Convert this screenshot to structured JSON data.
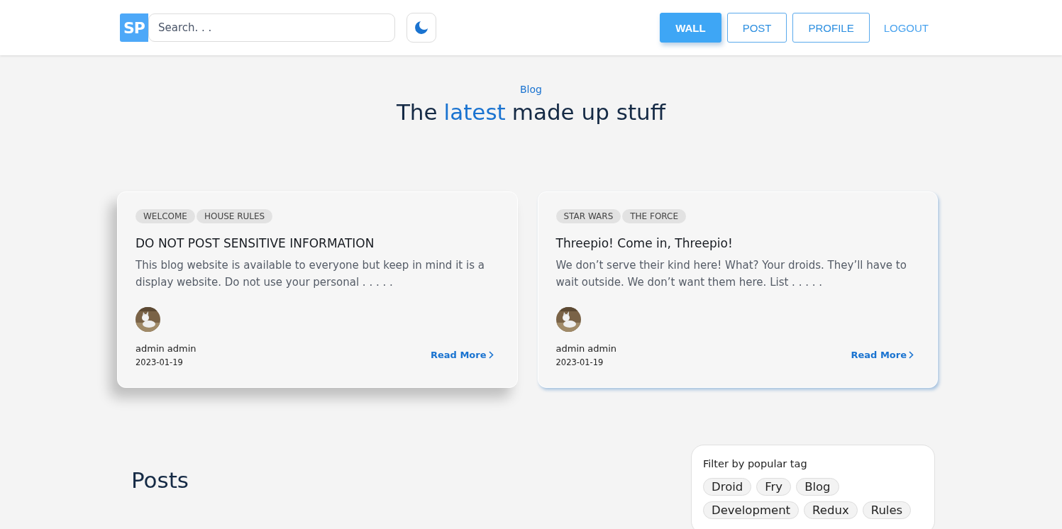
{
  "header": {
    "logo": "SP",
    "search": {
      "placeholder": "Search. . ."
    },
    "nav": [
      {
        "label": "WALL",
        "selected": true,
        "kind": "button"
      },
      {
        "label": "POST",
        "selected": false,
        "kind": "button"
      },
      {
        "label": "PROFILE",
        "selected": false,
        "kind": "button"
      },
      {
        "label": "LOGOUT",
        "selected": false,
        "kind": "link"
      }
    ]
  },
  "hero": {
    "eyebrow": "Blog",
    "title": [
      {
        "text": "The",
        "highlight": false
      },
      {
        "text": "latest",
        "highlight": true
      },
      {
        "text": "made up stuff",
        "highlight": false
      }
    ]
  },
  "featured": [
    {
      "tags": [
        "WELCOME",
        "HOUSE RULES"
      ],
      "title": "DO NOT POST SENSITIVE INFORMATION",
      "excerpt": "This blog website is available to everyone but keep in mind it is a display website. Do not use your personal . . . . .",
      "author": "admin admin",
      "date": "2023-01-19",
      "link": "Read More",
      "raised": true
    },
    {
      "tags": [
        "STAR WARS",
        "THE FORCE"
      ],
      "title": "Threepio! Come in, Threepio!",
      "excerpt": "We don’t serve their kind here! What? Your droids. They’ll have to wait outside. We don’t want them here. List . . . . .",
      "author": "admin admin",
      "date": "2023-01-19",
      "link": "Read More",
      "raised": false
    }
  ],
  "posts": {
    "heading": "Posts"
  },
  "filter": {
    "title": "Filter by popular tag",
    "tags": [
      "Droid",
      "Fry",
      "Blog",
      "Development",
      "Redux",
      "Rules"
    ]
  }
}
